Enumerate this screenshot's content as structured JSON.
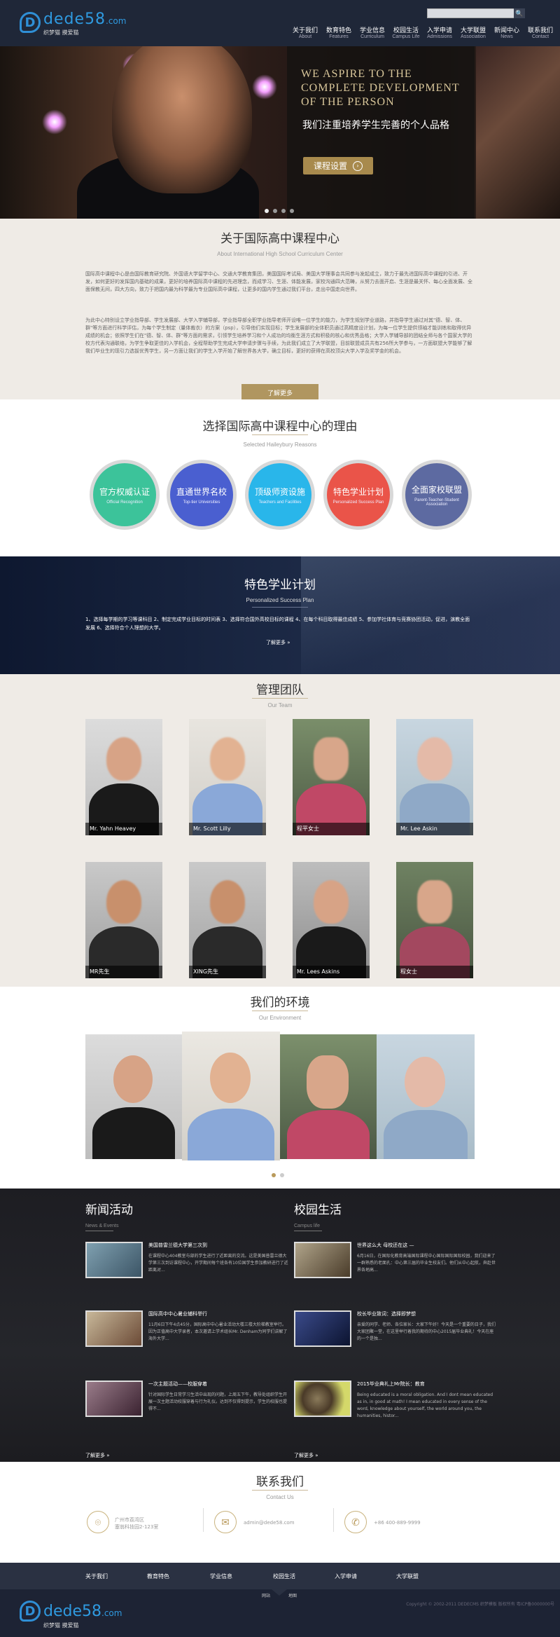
{
  "header": {
    "logo_mark": "D",
    "logo_word": "dede",
    "logo_num": "58",
    "logo_com": ".com",
    "logo_sub": "织梦猫 摸爱猫",
    "search_btn": "🔍",
    "nav": [
      {
        "cn": "关于我们",
        "en": "About"
      },
      {
        "cn": "数育特色",
        "en": "Features"
      },
      {
        "cn": "学业信息",
        "en": "Curriculum"
      },
      {
        "cn": "校园生活",
        "en": "Campus Life"
      },
      {
        "cn": "入学申请",
        "en": "Admissions"
      },
      {
        "cn": "大学联盟",
        "en": "Association"
      },
      {
        "cn": "新闻中心",
        "en": "News"
      },
      {
        "cn": "联系我们",
        "en": "Contact"
      }
    ]
  },
  "hero": {
    "en": "We aspire to the complete development of the person",
    "cn": "我们注重培养学生完善的个人品格",
    "button": "课程设置",
    "button_icon": "›",
    "slides_total": 4,
    "slide_active": 1
  },
  "about": {
    "title": "关于国际高中课程中心",
    "subtitle": "About International High School Curriculum Center",
    "p1": "国际高中课程中心是由国际教育研究院、外国语大学留学中心、交通大学教育集团，美国国际考试局、美国大学理事会共同参与发起成立，致力于最先进国际高中课程的引进、开发，如何更好的发挥国内基础的成果，更好的培养国际高中课程的先进理念，而成学习、生涯、体能发展，家校沟通四大范畴，从努力去面开启、生涯是最关怀、每心全面发展、全面保教无间，四大方向，致力于把国内最为科学最为专业国际高中课程，让更多的国内学生通过我们平台，走出中国走向世界。",
    "p2": "为此中心特别设立学业指导部、学生发展部、大学入学辅导部，学业指导部全职学业指导老师开设唯一位学生的能力，为学生规划学业道路，并指导学生通过对其\"德、智、体、群\"等方面进行科学评估，为每个学生制定（量体裁衣）的方案（psp），引导他们实现目标；学生发展部的全体职员通过高精度设计划，为每一位学生提供领袖才能训练和取得优异成绩的机会；依照学生们在\"德、智、体、群\"等方面的需求，引领学生培养学习和个人成功的均衡生涯方式和积极的核心和优秀品格；大学入学辅导部的团结全师与各个国家大学的校方代表沟通联络，为学生争取更佳的入学机会，全程帮助学生完成大学申请步骤与手续，为此我们成立了大学联盟，目前联盟成员共有256所大学参与，一方面联盟大学能够了解我们毕业生的现引力选拔优秀学生，另一方面让我们的学生入学开始了解世界各大学，确立目标，更好的获得在高校顶尖大学入学及奖学金的机会。",
    "button": "了解更多"
  },
  "reasons": {
    "title": "选择国际高中课程中心的理由",
    "subtitle": "Selected Haileybury Reasons",
    "items": [
      {
        "cn": "官方权威认证",
        "en": "Official Recognition",
        "color": "#3cc39a"
      },
      {
        "cn": "直通世界名校",
        "en": "Top-tier Universities",
        "color": "#4a5fd0"
      },
      {
        "cn": "顶级师资设施",
        "en": "Teachers and Facilities",
        "color": "#29b6ea"
      },
      {
        "cn": "特色学业计划",
        "en": "Personalized Success Plan",
        "color": "#ea5449"
      },
      {
        "cn": "全面家校联盟",
        "en": "Parent-Teacher-Student Association",
        "color": "#5d6aa1"
      }
    ]
  },
  "special": {
    "title": "特色学业计划",
    "subtitle": "Personalized Success Plan",
    "text": "1、选择每学期的学习等课科目 2、制定完成学业目标的时间表 3、选择符合国外高校目标的课程 4、在每个科目取得最佳成绩 5、参加学社体育与竞赛协团活动，促进，演教全面发展 6、选择符合个人理想的大学。",
    "more": "了解更多 »"
  },
  "team": {
    "title": "管理团队",
    "subtitle": "Our Team",
    "members": [
      {
        "name": "Mr. Yahn Heavey"
      },
      {
        "name": "Mr. Scott Lilly"
      },
      {
        "name": "程平女士"
      },
      {
        "name": "Mr. Lee Askin"
      },
      {
        "name": "MR先生"
      },
      {
        "name": "XING先生"
      },
      {
        "name": "Mr. Lees Askins"
      },
      {
        "name": "程女士"
      }
    ]
  },
  "environment": {
    "title": "我们的环境",
    "subtitle": "Our Environment"
  },
  "news": {
    "left_title": "新闻活动",
    "left_sub": "News & Events",
    "right_title": "校园生活",
    "right_sub": "Campus life",
    "left": [
      {
        "t": "美国普雷兰德大学第三次到",
        "d": "在课程中心404教室与部的学生进行了近距离的交流。这是美国普雷兰德大学第三次到访课程中心，开学期间每个班各有10位国学生参加教研进行了近距离对..."
      },
      {
        "t": "国际高中中心暑业辅科举行",
        "d": "11月6日下午4点45分，国际高中中心暑业活动大楼三楼大阶梯教室举行。因为正值高中大学录者，本次邀请上学术组长Mr. Denham为同学们讲解了海外大学..."
      },
      {
        "t": "一次主题活动——校服穿着",
        "d": "针对国际学生日常学习生活中出现的问题，上周五下午，教导处组织学生开展一次主题活动校服穿着与行为礼仪。达到不仅得到提示，学生的校服也提得不..."
      }
    ],
    "right": [
      {
        "t": "世界这么大 母校还在这 —",
        "d": "6月16日，在国际化教育高端国际课程中心国际国际国际校园，我们迎来了一群熟悉的老面孔：中心第三届的毕业生校友们。他们从中心起航，奔赴世界各地高..."
      },
      {
        "t": "校长毕业致词：选择即梦想",
        "d": "亲爱的同学、老师、各位家长：大家下午好！今天是一个重要的日子，我们大家团聚一堂，在这里举行着我的期待的中心2015届毕业典礼！今天在座的一个是独..."
      },
      {
        "t": "2015毕业典礼上Mr院长：教育",
        "d": "Being educated is a moral obligation. And I dont mean educated as in, in good at math! I mean educated in every sense of the word, knowledge about yourself, the world around you, the humanities, histor..."
      }
    ],
    "left_more": "了解更多 »",
    "right_more": "了解更多 »"
  },
  "contact": {
    "title": "联系我们",
    "subtitle": "Contact Us",
    "address": "广州市荔湾区\n塞翁科技园2-123室",
    "email": "admin@dede58.com",
    "phone": "+86 400-889-9999",
    "icons": {
      "address": "location-pin-icon",
      "email": "mail-icon",
      "phone": "phone-icon"
    }
  },
  "footer": {
    "nav": [
      "关于我们",
      "教育特色",
      "学业信息",
      "校园生活",
      "入学申请",
      "大学联盟"
    ],
    "left_link": "网站",
    "right_link": "地图",
    "copyright": "Copyright © 2002-2011 DEDECMS 织梦模板 版权所有 粤ICP备0000000号"
  }
}
